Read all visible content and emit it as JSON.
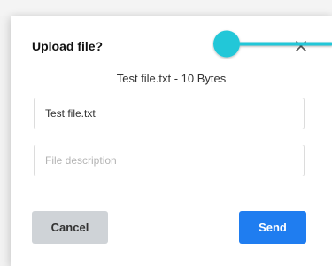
{
  "dialog": {
    "title": "Upload file?",
    "file_summary": "Test file.txt - 10 Bytes",
    "filename_value": "Test file.txt",
    "description_placeholder": "File description",
    "cancel_label": "Cancel",
    "send_label": "Send"
  },
  "icons": {
    "close": "close-icon",
    "pointer": "cursor-pointer-indicator"
  },
  "colors": {
    "send_button": "#1f7df0",
    "cancel_button": "#cfd3d7",
    "pointer_indicator": "#22c7d8"
  }
}
